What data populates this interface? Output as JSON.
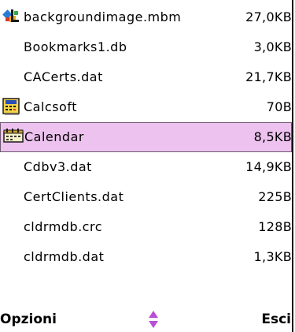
{
  "files": [
    {
      "name": "backgroundimage.mbm",
      "size": "27,0KB",
      "icon": "image-file-icon"
    },
    {
      "name": "Bookmarks1.db",
      "size": "3,0KB",
      "icon": ""
    },
    {
      "name": "CACerts.dat",
      "size": "21,7KB",
      "icon": ""
    },
    {
      "name": "Calcsoft",
      "size": "70B",
      "icon": "calculator-app-icon"
    },
    {
      "name": "Calendar",
      "size": "8,5KB",
      "icon": "calendar-app-icon",
      "selected": true
    },
    {
      "name": "Cdbv3.dat",
      "size": "14,9KB",
      "icon": ""
    },
    {
      "name": "CertClients.dat",
      "size": "225B",
      "icon": ""
    },
    {
      "name": "cldrmdb.crc",
      "size": "128B",
      "icon": ""
    },
    {
      "name": "cldrmdb.dat",
      "size": "1,3KB",
      "icon": ""
    }
  ],
  "softkeys": {
    "left": "Opzioni",
    "right": "Esci",
    "scroll_indicator_icon": "scroll-up-down-icon"
  },
  "colors": {
    "selection_background": "#edc2ef",
    "selection_border": "#6b5a6e",
    "scroll_arrow": "#b84fd6"
  }
}
